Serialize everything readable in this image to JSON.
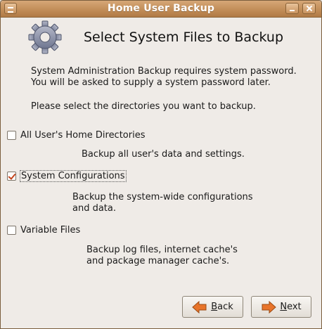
{
  "window": {
    "title": "Home User Backup"
  },
  "header": {
    "heading": "Select System Files to Backup",
    "icon": "gear-icon"
  },
  "intro": {
    "line1": "System Administration Backup requires system password.",
    "line2": "You will be asked to supply a system password later.",
    "line3": "Please select the directories you want to backup."
  },
  "options": [
    {
      "label": "All User's Home Directories",
      "checked": false,
      "description": [
        "Backup all user's data and settings."
      ]
    },
    {
      "label": "System Configurations",
      "checked": true,
      "description": [
        "Backup the system-wide configurations",
        "and data."
      ]
    },
    {
      "label": "Variable Files",
      "checked": false,
      "description": [
        "Backup log files, internet cache's",
        "and package manager cache's."
      ]
    }
  ],
  "buttons": {
    "back_first": "B",
    "back_rest": "ack",
    "next_first": "N",
    "next_rest": "ext"
  },
  "colors": {
    "titlebar": "#c08b56",
    "background": "#efebe7",
    "check": "#c4441c",
    "arrow": "#e8742a"
  }
}
